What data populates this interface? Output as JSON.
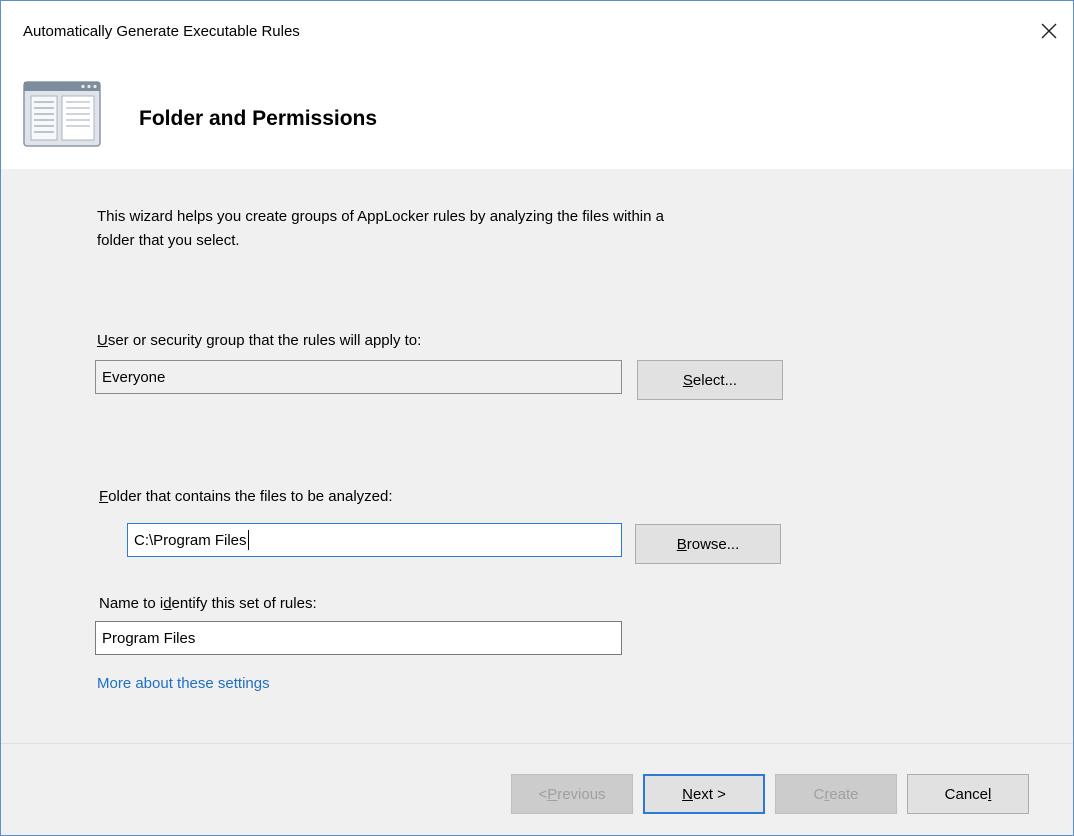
{
  "window": {
    "title": "Automatically Generate Executable Rules",
    "close_icon": "close-icon"
  },
  "header": {
    "title": "Folder and Permissions",
    "icon": "wizard-page-icon"
  },
  "intro": {
    "line1": "This wizard helps you create groups of AppLocker rules by analyzing the files within a",
    "line2": "folder that you select."
  },
  "user_group": {
    "label_mnemonic": "U",
    "label_rest": "ser or security group that the rules will apply to:",
    "value": "Everyone",
    "select_mnemonic": "S",
    "select_rest": "elect..."
  },
  "folder": {
    "label_mnemonic": "F",
    "label_rest": "older that contains the files to be analyzed:",
    "value": "C:\\Program Files",
    "browse_mnemonic": "B",
    "browse_rest": "rowse..."
  },
  "rule_name": {
    "label_pre": "Name to i",
    "label_mnemonic": "d",
    "label_rest": "entify this set of rules:",
    "value": "Program Files"
  },
  "help_link": "More about these settings",
  "footer": {
    "previous_pre": "< ",
    "previous_mnemonic": "P",
    "previous_rest": "revious",
    "next_mnemonic": "N",
    "next_rest": "ext >",
    "create_pre": "C",
    "create_mnemonic": "r",
    "create_rest": "eate",
    "cancel_pre": "Cance",
    "cancel_mnemonic": "l"
  },
  "colors": {
    "accent": "#2d7ad6",
    "link": "#1f6fc5",
    "dialog_bg": "#f0f0f0"
  }
}
